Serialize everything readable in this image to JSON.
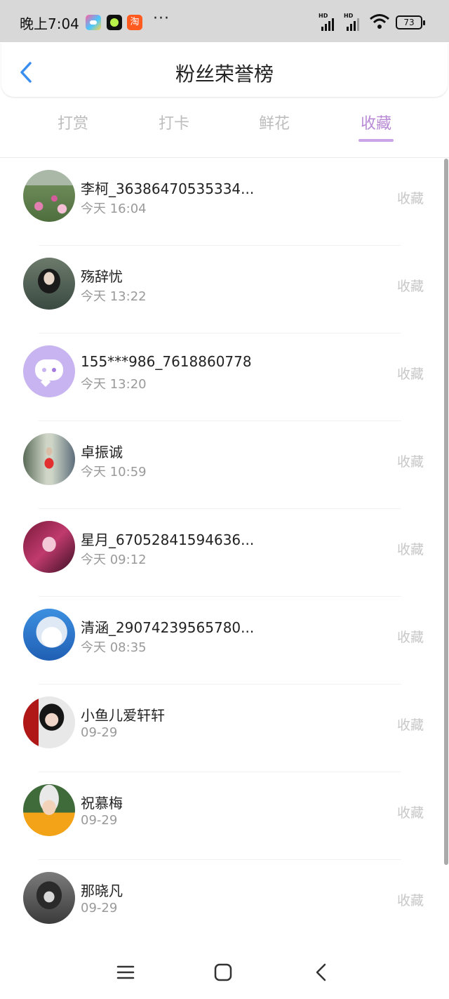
{
  "status_bar": {
    "time": "晚上7:04",
    "more": "···",
    "hd_label": "HD",
    "battery_level": "73",
    "icons": [
      "game-app-icon",
      "dot-app-icon",
      "taobao-app-icon",
      "signal-icon",
      "signal-icon",
      "wifi-icon",
      "battery-icon"
    ]
  },
  "header": {
    "title": "粉丝荣誉榜",
    "back_icon": "chevron-left-icon"
  },
  "tabs": [
    {
      "label": "打赏",
      "active": false
    },
    {
      "label": "打卡",
      "active": false
    },
    {
      "label": "鲜花",
      "active": false
    },
    {
      "label": "收藏",
      "active": true
    }
  ],
  "colors": {
    "accent": "#b88ad6",
    "indicator": "#c9a4e6",
    "back_icon": "#3a8ef0",
    "muted_text": "#9a9a9a",
    "action_text": "#c7c7c7"
  },
  "fans": [
    {
      "name": "李柯_36386470535334...",
      "time": "今天 16:04",
      "action": "收藏"
    },
    {
      "name": "殇辞忧",
      "time": "今天 13:22",
      "action": "收藏"
    },
    {
      "name": "155***986_7618860778",
      "time": "今天 13:20",
      "action": "收藏"
    },
    {
      "name": "卓振诚",
      "time": "今天 10:59",
      "action": "收藏"
    },
    {
      "name": "星月_67052841594636...",
      "time": "今天 09:12",
      "action": "收藏"
    },
    {
      "name": "清涵_29074239565780...",
      "time": "今天 08:35",
      "action": "收藏"
    },
    {
      "name": "小鱼儿爱轩轩",
      "time": "09-29",
      "action": "收藏"
    },
    {
      "name": "祝慕梅",
      "time": "09-29",
      "action": "收藏"
    },
    {
      "name": "那晓凡",
      "time": "09-29",
      "action": "收藏"
    }
  ],
  "nav_bar": {
    "icons": [
      "menu-icon",
      "home-icon",
      "back-icon"
    ]
  }
}
